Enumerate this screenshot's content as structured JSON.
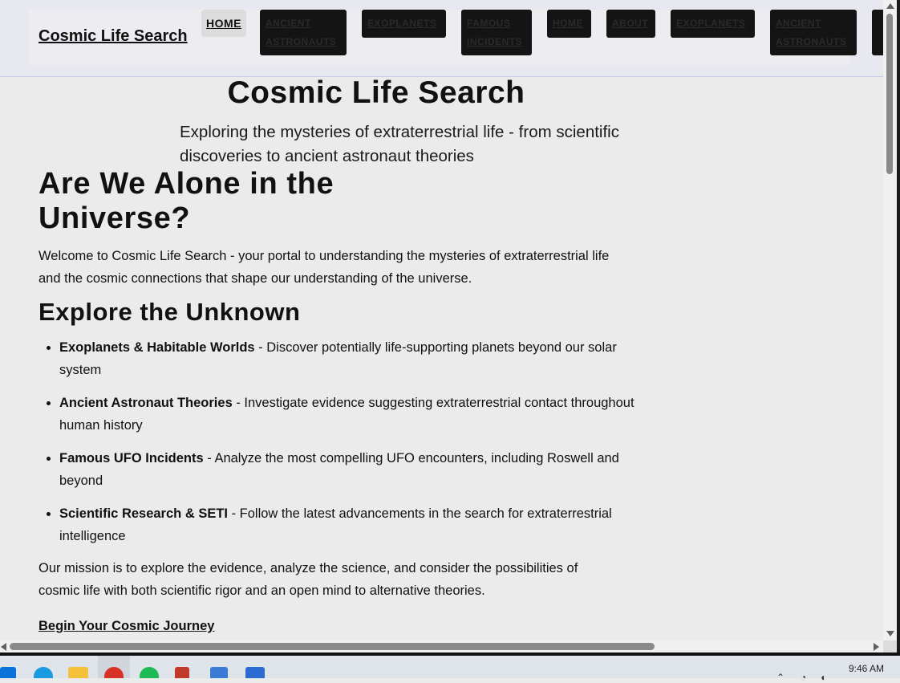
{
  "site": {
    "brand": "Cosmic Life Search",
    "nav": [
      {
        "label": "HOME",
        "active": true
      },
      {
        "label": "ANCIENT ASTRONAUTS"
      },
      {
        "label": "EXOPLANETS"
      },
      {
        "label": "FAMOUS INCIDENTS"
      },
      {
        "label": "HOME"
      },
      {
        "label": "ABOUT"
      },
      {
        "label": "EXOPLANETS"
      },
      {
        "label": "ANCIENT ASTRONAUTS"
      }
    ]
  },
  "hero": {
    "title": "Cosmic Life Search",
    "subtitle": "Exploring the mysteries of extraterrestrial life - from scientific discoveries to ancient astronaut theories"
  },
  "main": {
    "heading": "Are We Alone in the Universe?",
    "intro": "Welcome to Cosmic Life Search - your portal to understanding the mysteries of extraterrestrial life and the cosmic connections that shape our understanding of the universe.",
    "explore_heading": "Explore the Unknown",
    "features": [
      {
        "title": "Exoplanets & Habitable Worlds",
        "desc": " - Discover potentially life-supporting planets beyond our solar system"
      },
      {
        "title": "Ancient Astronaut Theories",
        "desc": " - Investigate evidence suggesting extraterrestrial contact throughout human history"
      },
      {
        "title": "Famous UFO Incidents",
        "desc": " - Analyze the most compelling UFO encounters, including Roswell and beyond"
      },
      {
        "title": "Scientific Research & SETI",
        "desc": " - Follow the latest advancements in the search for extraterrestrial intelligence"
      }
    ],
    "mission": "Our mission is to explore the evidence, analyze the science, and consider the possibilities of cosmic life with both scientific rigor and an open mind to alternative theories.",
    "cta": "Begin Your Cosmic Journey"
  },
  "taskbar": {
    "clock": "9:46 AM",
    "apps": [
      "windows-start-icon",
      "edge-icon",
      "file-explorer-icon",
      "chrome-icon",
      "spotify-icon",
      "app-icon",
      "notepad-icon",
      "terminal-icon"
    ],
    "colors": {
      "edge": "#1a9be0",
      "explorer": "#f4c13a",
      "chrome": "#d93025",
      "spotify": "#1db954",
      "start": "#0a73d9"
    }
  }
}
